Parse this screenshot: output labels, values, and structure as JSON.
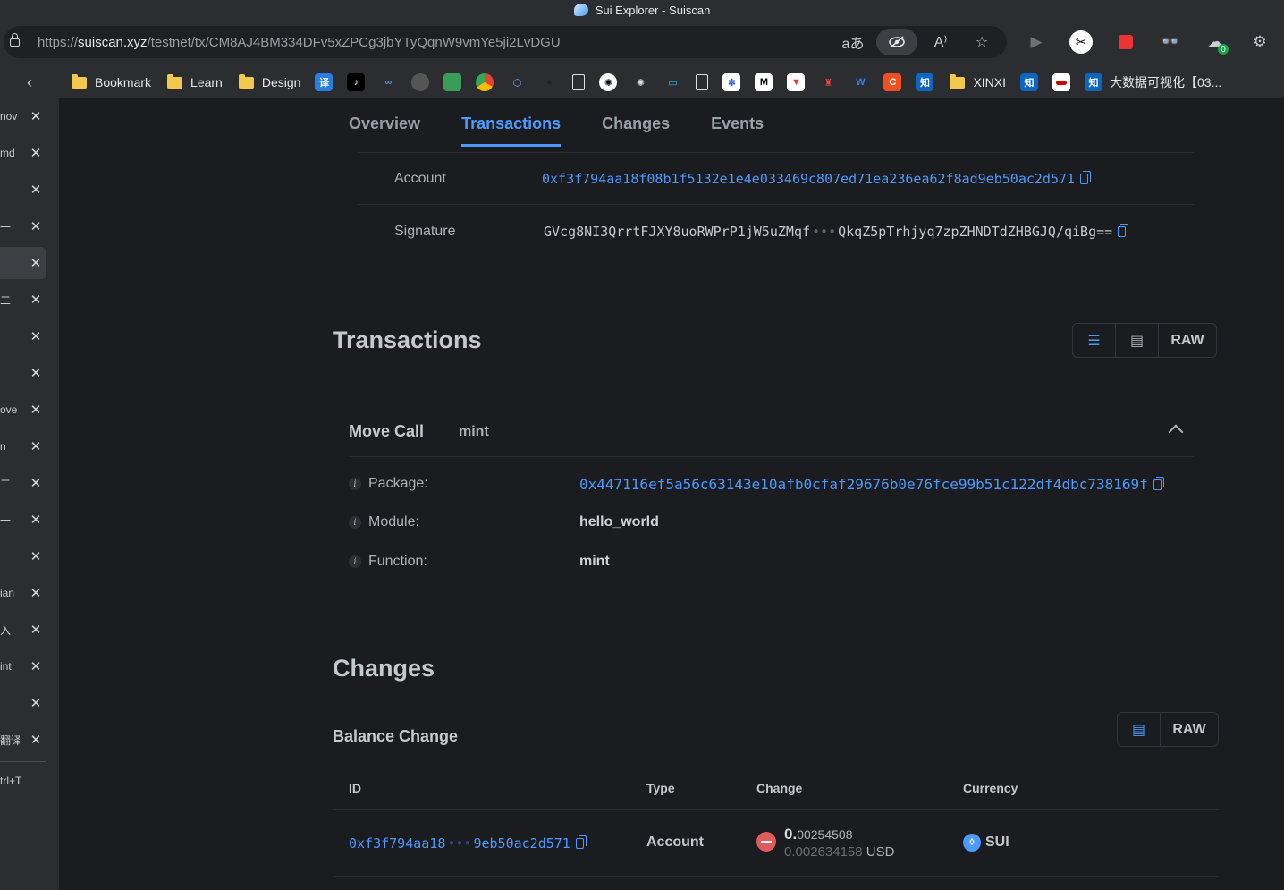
{
  "window": {
    "title": "Sui Explorer - Suiscan"
  },
  "address_bar": {
    "url_scheme": "https://",
    "url_host": "suiscan.xyz",
    "url_path": "/testnet/tx/CM8AJ4BM334DFv5xZPCg3jbYTyQqnW9vmYe5ji2LvDGU"
  },
  "extensions": {
    "badge_count": "0"
  },
  "bookmarks": [
    {
      "label": "Bookmark"
    },
    {
      "label": "Learn"
    },
    {
      "label": "Design"
    },
    {
      "label": "XINXI"
    },
    {
      "label": "大数据可视化【03..."
    }
  ],
  "vertical_tabs": {
    "labels": [
      "nov",
      "md",
      "",
      "一",
      "",
      "二",
      "",
      "",
      "ove",
      "n",
      "二",
      "一",
      "",
      "ian",
      "入",
      "int",
      "",
      "翻译"
    ],
    "new_tab_hint": "trl+T"
  },
  "page_tabs": [
    "Overview",
    "Transactions",
    "Changes",
    "Events"
  ],
  "signer": {
    "account_label": "Account",
    "account_value": "0xf3f794aa18f08b1f5132e1e4e033469c807ed71ea236ea62f8ad9eb50ac2d571",
    "signature_label": "Signature",
    "signature_start": "GVcg8NI3QrrtFJXY8uoRWPrP1jW5uZMqf",
    "signature_end": "QkqZ5pTrhjyq7zpZHNDTdZHBGJQ/qiBg==",
    "ellipsis": "•••"
  },
  "transactions": {
    "title": "Transactions",
    "raw_label": "RAW",
    "move_call": {
      "title": "Move Call",
      "function_name": "mint",
      "package_label": "Package:",
      "package_value": "0x447116ef5a56c63143e10afb0cfaf29676b0e76fce99b51c122df4dbc738169f",
      "module_label": "Module:",
      "module_value": "hello_world",
      "function_label": "Function:",
      "function_value": "mint"
    }
  },
  "changes": {
    "title": "Changes",
    "raw_label": "RAW",
    "balance_change": {
      "title": "Balance Change",
      "headers": [
        "ID",
        "Type",
        "Change",
        "Currency"
      ],
      "rows": [
        {
          "id_start": "0xf3f794aa18",
          "id_end": "9eb50ac2d571",
          "ellipsis": "•••",
          "type": "Account",
          "change_lead": "0.",
          "change_rest": "00254508",
          "usd_value": "0.002634158",
          "usd_unit": "USD",
          "currency": "SUI"
        }
      ]
    }
  },
  "colors": {
    "accent": "#4c9aff",
    "negative": "#e05c5c",
    "background": "#1b1c1f"
  }
}
